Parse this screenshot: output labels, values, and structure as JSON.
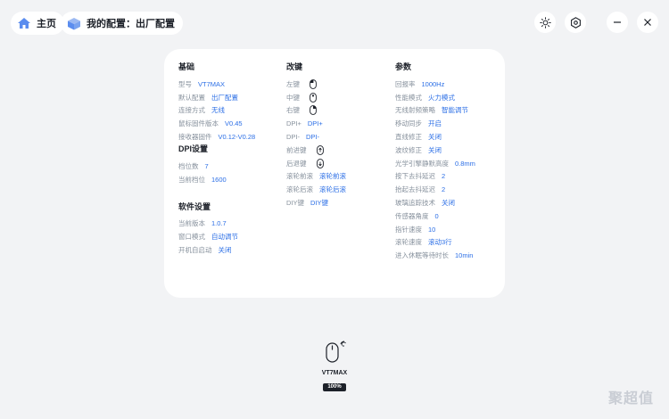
{
  "nav": {
    "home_label": "主页",
    "config_label": "我的配置：出厂配置"
  },
  "icons": {
    "home": "home-icon",
    "config": "cube-icon",
    "theme": "sun-icon",
    "settings": "gear-icon",
    "minimize": "minimize-icon",
    "close": "close-icon"
  },
  "colors": {
    "accent": "#2c6fe6",
    "label": "#86909c",
    "title": "#1d2129",
    "brand": "#5b8def"
  },
  "basic": {
    "title": "基础",
    "rows": [
      {
        "label": "型号",
        "value": "VT7MAX"
      },
      {
        "label": "默认配置",
        "value": "出厂配置"
      },
      {
        "label": "连接方式",
        "value": "无线"
      },
      {
        "label": "鼠标固件版本",
        "value": "V0.45"
      },
      {
        "label": "接收器固件",
        "value": "V0.12-V0.28"
      }
    ]
  },
  "dpi": {
    "title": "DPI设置",
    "rows": [
      {
        "label": "档位数",
        "value": "7"
      },
      {
        "label": "当前档位",
        "value": "1600"
      }
    ]
  },
  "software": {
    "title": "软件设置",
    "rows": [
      {
        "label": "当前版本",
        "value": "1.0.7"
      },
      {
        "label": "窗口模式",
        "value": "自动调节"
      },
      {
        "label": "开机自启动",
        "value": "关闭"
      }
    ]
  },
  "remap": {
    "title": "改键",
    "rows": [
      {
        "label": "左键",
        "value": "",
        "icon": "mouse-left-icon"
      },
      {
        "label": "中键",
        "value": "",
        "icon": "mouse-middle-icon"
      },
      {
        "label": "右键",
        "value": "",
        "icon": "mouse-right-icon"
      },
      {
        "label": "DPI+",
        "value": "DPI+"
      },
      {
        "label": "DPI-",
        "value": "DPI-"
      },
      {
        "label": "前进键",
        "value": "",
        "icon": "mouse-forward-icon"
      },
      {
        "label": "后退键",
        "value": "",
        "icon": "mouse-back-icon"
      },
      {
        "label": "滚轮前滚",
        "value": "滚轮前滚"
      },
      {
        "label": "滚轮后滚",
        "value": "滚轮后滚"
      },
      {
        "label": "DIY键",
        "value": "DIY键"
      }
    ]
  },
  "params": {
    "title": "参数",
    "rows": [
      {
        "label": "回报率",
        "value": "1000Hz"
      },
      {
        "label": "性能模式",
        "value": "火力模式"
      },
      {
        "label": "无线射频策略",
        "value": "智能调节"
      },
      {
        "label": "移动同步",
        "value": "开启"
      },
      {
        "label": "直线修正",
        "value": "关闭"
      },
      {
        "label": "波纹修正",
        "value": "关闭"
      },
      {
        "label": "光学引擎静默高度",
        "value": "0.8mm"
      },
      {
        "label": "按下去抖延迟",
        "value": "2"
      },
      {
        "label": "抬起去抖延迟",
        "value": "2"
      },
      {
        "label": "玻璃追踪技术",
        "value": "关闭"
      },
      {
        "label": "传感器角度",
        "value": "0"
      },
      {
        "label": "指针速度",
        "value": "10"
      },
      {
        "label": "滚轮速度",
        "value": "滚动3行"
      },
      {
        "label": "进入休眠等待时长",
        "value": "10min"
      }
    ]
  },
  "device": {
    "name": "VT7MAX",
    "battery_text": "100%",
    "battery_level": 1.0
  },
  "watermark": "聚超值"
}
